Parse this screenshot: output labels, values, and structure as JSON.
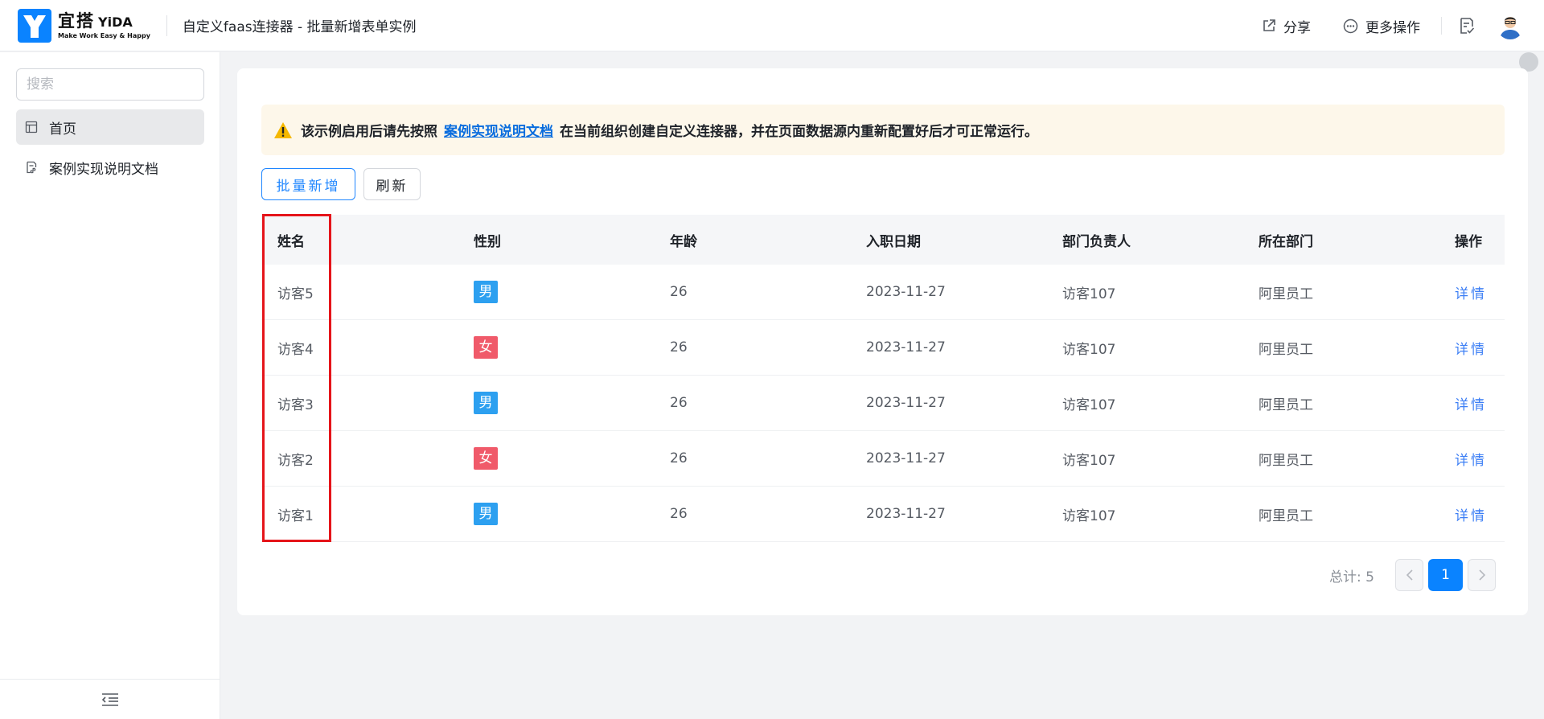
{
  "header": {
    "logo_cn": "宜搭",
    "logo_en": "YiDA",
    "logo_sub": "Make Work Easy & Happy",
    "title": "自定义faas连接器 - 批量新增表单实例",
    "share_label": "分享",
    "more_label": "更多操作"
  },
  "sidebar": {
    "search_placeholder": "搜索",
    "items": [
      {
        "label": "首页",
        "active": true
      },
      {
        "label": "案例实现说明文档",
        "active": false
      }
    ]
  },
  "notice": {
    "prefix": "该示例启用后请先按照",
    "link": "案例实现说明文档",
    "suffix": "在当前组织创建自定义连接器，并在页面数据源内重新配置好后才可正常运行。"
  },
  "toolbar": {
    "batch_add_label": "批量新增",
    "refresh_label": "刷新"
  },
  "table": {
    "columns": [
      "姓名",
      "性别",
      "年龄",
      "入职日期",
      "部门负责人",
      "所在部门",
      "操作"
    ],
    "rows": [
      {
        "name": "访客5",
        "gender": "男",
        "age": "26",
        "date": "2023-11-27",
        "leader": "访客107",
        "dept": "阿里员工",
        "action": "详情"
      },
      {
        "name": "访客4",
        "gender": "女",
        "age": "26",
        "date": "2023-11-27",
        "leader": "访客107",
        "dept": "阿里员工",
        "action": "详情"
      },
      {
        "name": "访客3",
        "gender": "男",
        "age": "26",
        "date": "2023-11-27",
        "leader": "访客107",
        "dept": "阿里员工",
        "action": "详情"
      },
      {
        "name": "访客2",
        "gender": "女",
        "age": "26",
        "date": "2023-11-27",
        "leader": "访客107",
        "dept": "阿里员工",
        "action": "详情"
      },
      {
        "name": "访客1",
        "gender": "男",
        "age": "26",
        "date": "2023-11-27",
        "leader": "访客107",
        "dept": "阿里员工",
        "action": "详情"
      }
    ]
  },
  "pagination": {
    "total_label": "总计: 5",
    "current_page": "1"
  },
  "colors": {
    "accent": "#0a83ff",
    "male_tag": "#2da0f0",
    "female_tag": "#f05a6a",
    "highlight": "#e5141a"
  }
}
